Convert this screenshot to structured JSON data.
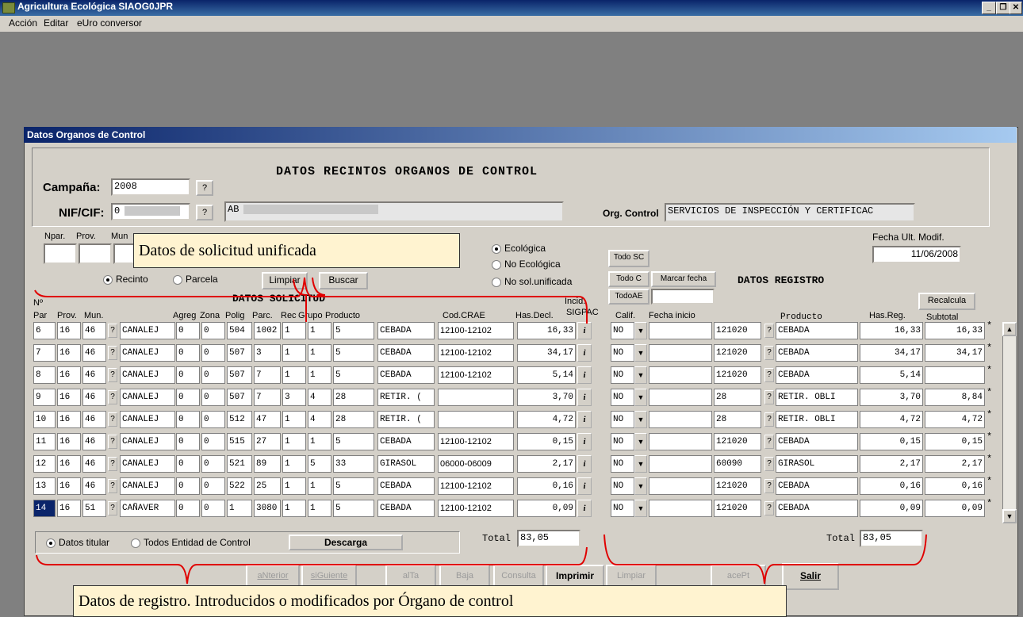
{
  "window": {
    "title": "Agricultura Ecológica    SIAOG0JPR"
  },
  "menu": [
    "Acción",
    "Editar",
    "eUro conversor"
  ],
  "dialog": {
    "title": "Datos Organos de Control",
    "heading": "DATOS RECINTOS ORGANOS DE CONTROL",
    "campana_label": "Campaña:",
    "campana_value": "2008",
    "nif_label": "NIF/CIF:",
    "nif_value": "0",
    "name_value": "AB",
    "org_label": "Org. Control",
    "org_value": "SERVICIOS DE INSPECCIÓN Y CERTIFICAC",
    "q": "?"
  },
  "filters": {
    "npar": "Npar.",
    "prov": "Prov.",
    "mun": "Mun",
    "recinto": "Recinto",
    "parcela": "Parcela",
    "limpiar": "Limpiar",
    "buscar": "Buscar",
    "radios": [
      "Ecológica",
      "No Ecológica",
      "No sol.unificada"
    ]
  },
  "right_top": {
    "todo_sc": "Todo SC",
    "todo_c": "Todo C",
    "marcar_fecha": "Marcar fecha",
    "todo_ae": "TodoAE",
    "fecha_label": "Fecha Ult. Modif.",
    "fecha_value": "11/06/2008",
    "registro_heading": "DATOS REGISTRO",
    "recalcula": "Recalcula"
  },
  "solicitud": {
    "heading": "DATOS SOLICITUD",
    "incid": "Incid.",
    "sigpac": "SIGPAC",
    "headers": {
      "n": "Nº",
      "par": "Par",
      "prov": "Prov.",
      "mun": "Mun.",
      "agreg": "Agreg",
      "zona": "Zona",
      "polig": "Polig",
      "parc": "Parc.",
      "rec": "Rec",
      "grupo": "Grupo",
      "producto": "Producto",
      "crae": "Cod.CRAE",
      "has": "Has.Decl."
    }
  },
  "registro": {
    "headers": {
      "calif": "Calif.",
      "fecha": "Fecha inicio",
      "producto": "Producto",
      "has": "Has.Reg.",
      "subtotal": "Subtotal"
    }
  },
  "rows": [
    {
      "par": "6",
      "prov": "16",
      "mun": "46",
      "mun_name": "CANALEJ",
      "agreg": "0",
      "zona": "0",
      "polig": "504",
      "parc": "1002",
      "rec": "1",
      "grupo": "1",
      "prod": "5",
      "prod_name": "CEBADA",
      "crae": "12100-12102",
      "has": "16,33",
      "calif": "NO",
      "pcode": "121020",
      "pname": "CEBADA",
      "hasreg": "16,33",
      "sub": "16,33"
    },
    {
      "par": "7",
      "prov": "16",
      "mun": "46",
      "mun_name": "CANALEJ",
      "agreg": "0",
      "zona": "0",
      "polig": "507",
      "parc": "3",
      "rec": "1",
      "grupo": "1",
      "prod": "5",
      "prod_name": "CEBADA",
      "crae": "12100-12102",
      "has": "34,17",
      "calif": "NO",
      "pcode": "121020",
      "pname": "CEBADA",
      "hasreg": "34,17",
      "sub": "34,17"
    },
    {
      "par": "8",
      "prov": "16",
      "mun": "46",
      "mun_name": "CANALEJ",
      "agreg": "0",
      "zona": "0",
      "polig": "507",
      "parc": "7",
      "rec": "1",
      "grupo": "1",
      "prod": "5",
      "prod_name": "CEBADA",
      "crae": "12100-12102",
      "has": "5,14",
      "calif": "NO",
      "pcode": "121020",
      "pname": "CEBADA",
      "hasreg": "5,14",
      "sub": ""
    },
    {
      "par": "9",
      "prov": "16",
      "mun": "46",
      "mun_name": "CANALEJ",
      "agreg": "0",
      "zona": "0",
      "polig": "507",
      "parc": "7",
      "rec": "3",
      "grupo": "4",
      "prod": "28",
      "prod_name": "RETIR. (",
      "crae": "",
      "has": "3,70",
      "calif": "NO",
      "pcode": "28",
      "pname": "RETIR. OBLI",
      "hasreg": "3,70",
      "sub": "8,84"
    },
    {
      "par": "10",
      "prov": "16",
      "mun": "46",
      "mun_name": "CANALEJ",
      "agreg": "0",
      "zona": "0",
      "polig": "512",
      "parc": "47",
      "rec": "1",
      "grupo": "4",
      "prod": "28",
      "prod_name": "RETIR. (",
      "crae": "",
      "has": "4,72",
      "calif": "NO",
      "pcode": "28",
      "pname": "RETIR. OBLI",
      "hasreg": "4,72",
      "sub": "4,72"
    },
    {
      "par": "11",
      "prov": "16",
      "mun": "46",
      "mun_name": "CANALEJ",
      "agreg": "0",
      "zona": "0",
      "polig": "515",
      "parc": "27",
      "rec": "1",
      "grupo": "1",
      "prod": "5",
      "prod_name": "CEBADA",
      "crae": "12100-12102",
      "has": "0,15",
      "calif": "NO",
      "pcode": "121020",
      "pname": "CEBADA",
      "hasreg": "0,15",
      "sub": "0,15"
    },
    {
      "par": "12",
      "prov": "16",
      "mun": "46",
      "mun_name": "CANALEJ",
      "agreg": "0",
      "zona": "0",
      "polig": "521",
      "parc": "89",
      "rec": "1",
      "grupo": "5",
      "prod": "33",
      "prod_name": "GIRASOL",
      "crae": "06000-06009",
      "has": "2,17",
      "calif": "NO",
      "pcode": "60090",
      "pname": "GIRASOL",
      "hasreg": "2,17",
      "sub": "2,17"
    },
    {
      "par": "13",
      "prov": "16",
      "mun": "46",
      "mun_name": "CANALEJ",
      "agreg": "0",
      "zona": "0",
      "polig": "522",
      "parc": "25",
      "rec": "1",
      "grupo": "1",
      "prod": "5",
      "prod_name": "CEBADA",
      "crae": "12100-12102",
      "has": "0,16",
      "calif": "NO",
      "pcode": "121020",
      "pname": "CEBADA",
      "hasreg": "0,16",
      "sub": "0,16"
    },
    {
      "par": "14",
      "prov": "16",
      "mun": "51",
      "mun_name": "CAÑAVER",
      "agreg": "0",
      "zona": "0",
      "polig": "1",
      "parc": "3080",
      "rec": "1",
      "grupo": "1",
      "prod": "5",
      "prod_name": "CEBADA",
      "crae": "12100-12102",
      "has": "0,09",
      "calif": "NO",
      "pcode": "121020",
      "pname": "CEBADA",
      "hasreg": "0,09",
      "sub": "0,09"
    }
  ],
  "totals": {
    "label": "Total",
    "decl": "83,05",
    "reg": "83,05"
  },
  "bottom": {
    "datos_titular": "Datos titular",
    "todos_entidad": "Todos Entidad de Control",
    "descarga": "Descarga",
    "buttons": [
      "aNterior",
      "siGuiente",
      "alTa",
      "Baja",
      "Consulta",
      "Imprimir",
      "Limpiar",
      "acePt",
      "Salir"
    ]
  },
  "callouts": {
    "solicitud": "Datos de solicitud unificada",
    "registro": "Datos de registro. Introducidos o modificados por Órgano de control"
  },
  "accent": {
    "highlight": "#e00000",
    "title": "#0a246a"
  }
}
